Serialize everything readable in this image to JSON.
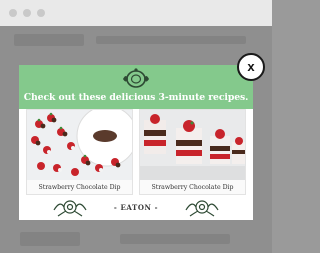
{
  "modal": {
    "headline": "Check out these delicious 3-minute recipes.",
    "cards": [
      {
        "caption": "Strawberry Chocolate Dip"
      },
      {
        "caption": "Strawberry Chocolate Dip"
      }
    ],
    "brand": "- EATON -",
    "close_label": "x"
  },
  "colors": {
    "header_green": "#84c98c",
    "overlay": "#8f8f8f",
    "strawberry": "#c8242b",
    "chocolate": "#4a2a1c"
  },
  "icons": [
    "window-dot-icon",
    "plate-logo-icon",
    "flower-decoration-icon",
    "close-icon"
  ]
}
